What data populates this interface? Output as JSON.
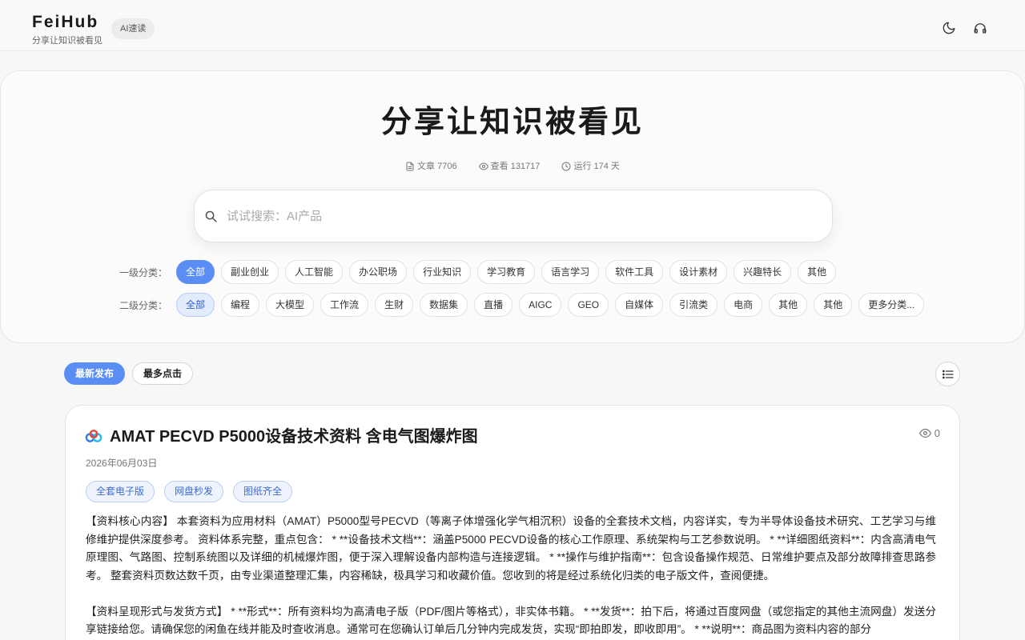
{
  "header": {
    "brand_name": "FeiHub",
    "brand_sub": "分享让知识被看见",
    "badge": "AI速读",
    "icons": [
      "moon-icon",
      "headphones-icon"
    ]
  },
  "hero": {
    "title": "分享让知识被看见",
    "stats": {
      "articles": "文章 7706",
      "views": "查看 131717",
      "uptime": "运行 174 天"
    },
    "search_placeholder": "试试搜索：AI产品",
    "level1_label": "一级分类：",
    "level1": [
      "全部",
      "副业创业",
      "人工智能",
      "办公职场",
      "行业知识",
      "学习教育",
      "语言学习",
      "软件工具",
      "设计素材",
      "兴趣特长",
      "其他"
    ],
    "level2_label": "二级分类：",
    "level2": [
      "全部",
      "编程",
      "大模型",
      "工作流",
      "生财",
      "数据集",
      "直播",
      "AIGC",
      "GEO",
      "自媒体",
      "引流类",
      "电商",
      "其他",
      "其他",
      "更多分类..."
    ]
  },
  "sort": {
    "latest": "最新发布",
    "popular": "最多点击"
  },
  "article": {
    "title": "AMAT PECVD P5000设备技术资料 含电气图爆炸图",
    "views": "0",
    "date": "2026年06月03日",
    "tags": [
      "全套电子版",
      "网盘秒发",
      "图纸齐全"
    ],
    "para1": "【资料核心内容】 本套资料为应用材料（AMAT）P5000型号PECVD（等离子体增强化学气相沉积）设备的全套技术文档，内容详实，专为半导体设备技术研究、工艺学习与维修维护提供深度参考。 资料体系完整，重点包含： * **设备技术文档**：涵盖P5000 PECVD设备的核心工作原理、系统架构与工艺参数说明。 * **详细图纸资料**：内含高清电气原理图、气路图、控制系统图以及详细的机械爆炸图，便于深入理解设备内部构造与连接逻辑。 * **操作与维护指南**：包含设备操作规范、日常维护要点及部分故障排查思路参考。 整套资料页数达数千页，由专业渠道整理汇集，内容稀缺，极具学习和收藏价值。您收到的将是经过系统化归类的电子版文件，查阅便捷。",
    "para2": "【资料呈现形式与发货方式】 * **形式**：所有资料均为高清电子版（PDF/图片等格式），非实体书籍。 * **发货**：拍下后，将通过百度网盘（或您指定的其他主流网盘）发送分享链接给您。请确保您的闲鱼在线并能及时查收消息。通常可在您确认订单后几分钟内完成发货，实现“即拍即发，即收即用”。 * **说明**：商品图为资料内容的部分"
  },
  "colors": {
    "accent": "#5b8ef5",
    "tag_bg": "#eef3fd",
    "tag_text": "#3b6cd3"
  }
}
